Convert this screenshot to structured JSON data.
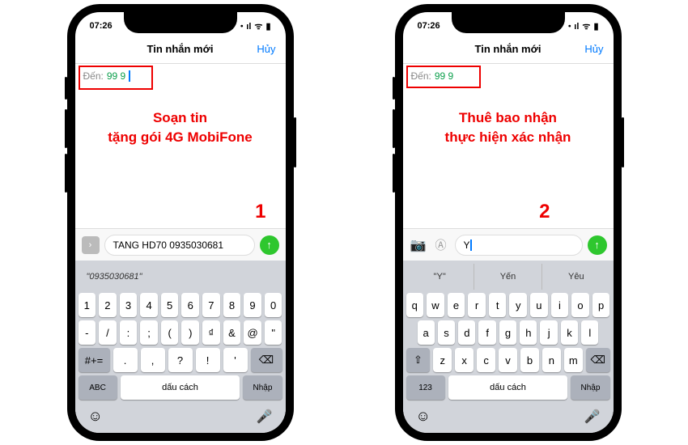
{
  "status": {
    "time": "07:26",
    "signal": "・ıl",
    "wifi": "⌃",
    "battery": "■"
  },
  "nav": {
    "title": "Tin nhắn mới",
    "cancel": "Hủy"
  },
  "to": {
    "label": "Đến:",
    "value": "99 9"
  },
  "phone1": {
    "annotation_l1": "Soạn tin",
    "annotation_l2": "tặng gói 4G MobiFone",
    "step": "1",
    "message": "TANG HD70 0935030681",
    "suggest": "\"0935030681\"",
    "rows": {
      "r1": [
        "1",
        "2",
        "3",
        "4",
        "5",
        "6",
        "7",
        "8",
        "9",
        "0"
      ],
      "r2": [
        "-",
        "/",
        ":",
        ";",
        "(",
        ")",
        "₫",
        "&",
        "@",
        "\""
      ],
      "r3": [
        ".",
        ",",
        "?",
        "!",
        "'"
      ],
      "bottom": {
        "abc": "ABC",
        "space": "dấu cách",
        "enter": "Nhập",
        "sym": "#+="
      }
    }
  },
  "phone2": {
    "annotation_l1": "Thuê bao nhận",
    "annotation_l2": "thực hiện xác nhận",
    "step": "2",
    "message": "Y",
    "suggests": [
      "\"Y\"",
      "Yến",
      "Yêu"
    ],
    "rows": {
      "r1": [
        "q",
        "w",
        "e",
        "r",
        "t",
        "y",
        "u",
        "i",
        "o",
        "p"
      ],
      "r2": [
        "a",
        "s",
        "d",
        "f",
        "g",
        "h",
        "j",
        "k",
        "l"
      ],
      "r3": [
        "z",
        "x",
        "c",
        "v",
        "b",
        "n",
        "m"
      ],
      "bottom": {
        "num": "123",
        "space": "dấu cách",
        "enter": "Nhập"
      }
    }
  }
}
